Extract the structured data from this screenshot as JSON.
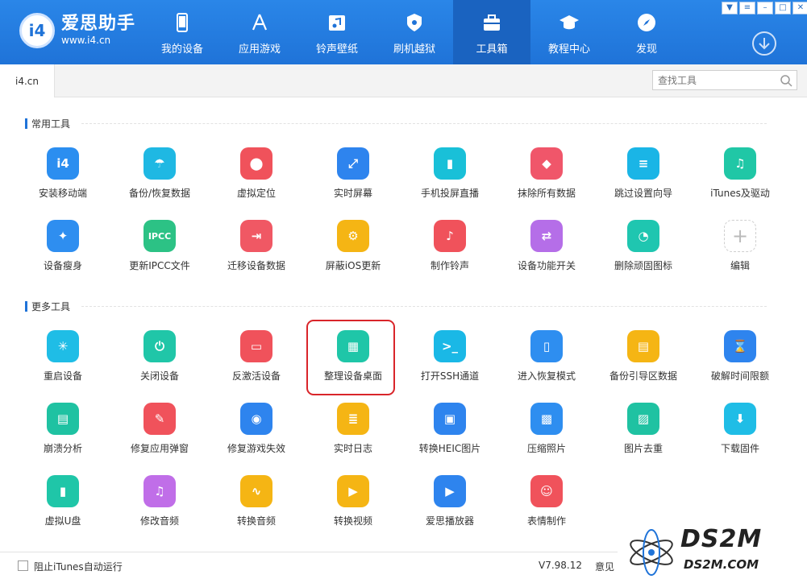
{
  "app": {
    "brand_name": "爱思助手",
    "brand_url": "www.i4.cn",
    "logo_text": "i4"
  },
  "window_buttons": [
    "shirt-icon",
    "menu-icon",
    "minimize-icon",
    "maximize-icon",
    "close-icon"
  ],
  "nav": [
    {
      "label": "我的设备",
      "icon": "phone-icon"
    },
    {
      "label": "应用游戏",
      "icon": "appstore-icon"
    },
    {
      "label": "铃声壁纸",
      "icon": "music-icon"
    },
    {
      "label": "刷机越狱",
      "icon": "flash-icon"
    },
    {
      "label": "工具箱",
      "icon": "toolbox-icon",
      "active": true
    },
    {
      "label": "教程中心",
      "icon": "graduation-icon"
    },
    {
      "label": "发现",
      "icon": "compass-icon"
    }
  ],
  "tabs": [
    {
      "label": "i4.cn"
    }
  ],
  "search": {
    "placeholder": "查找工具"
  },
  "sections": {
    "common": "常用工具",
    "more": "更多工具"
  },
  "common_tools": [
    {
      "label": "安装移动端",
      "color": "#2b8ef0",
      "glyph": "i4"
    },
    {
      "label": "备份/恢复数据",
      "color": "#1fb8e3",
      "glyph": "☂"
    },
    {
      "label": "虚拟定位",
      "color": "#f0525b",
      "glyph": "⬤"
    },
    {
      "label": "实时屏幕",
      "color": "#2e84ee",
      "glyph": "⤢"
    },
    {
      "label": "手机投屏直播",
      "color": "#19c0d8",
      "glyph": "▮"
    },
    {
      "label": "抹除所有数据",
      "color": "#f0566a",
      "glyph": "◆"
    },
    {
      "label": "跳过设置向导",
      "color": "#1ab5e6",
      "glyph": "≡"
    },
    {
      "label": "iTunes及驱动",
      "color": "#20c7a6",
      "glyph": "♫"
    },
    {
      "label": "设备瘦身",
      "color": "#2e8ef0",
      "glyph": "✦"
    },
    {
      "label": "更新IPCC文件",
      "color": "#2cc285",
      "glyph": "IPCC"
    },
    {
      "label": "迁移设备数据",
      "color": "#f05864",
      "glyph": "⇥"
    },
    {
      "label": "屏蔽iOS更新",
      "color": "#f5b514",
      "glyph": "⚙"
    },
    {
      "label": "制作铃声",
      "color": "#f0525b",
      "glyph": "♪"
    },
    {
      "label": "设备功能开关",
      "color": "#b56ee8",
      "glyph": "⇄"
    },
    {
      "label": "删除顽固图标",
      "color": "#1fc6b0",
      "glyph": "◔"
    },
    {
      "label": "编辑",
      "color": "#ffffff",
      "glyph": "+",
      "dashed": true
    }
  ],
  "more_tools": [
    {
      "label": "重启设备",
      "color": "#1fbde6",
      "glyph": "✳"
    },
    {
      "label": "关闭设备",
      "color": "#20c6a8",
      "glyph": "⏻"
    },
    {
      "label": "反激活设备",
      "color": "#f0525b",
      "glyph": "▭"
    },
    {
      "label": "整理设备桌面",
      "color": "#1fc6a8",
      "glyph": "▦"
    },
    {
      "label": "打开SSH通道",
      "color": "#1ab8e6",
      "glyph": ">_"
    },
    {
      "label": "进入恢复模式",
      "color": "#2e8ef0",
      "glyph": "▯"
    },
    {
      "label": "备份引导区数据",
      "color": "#f5b514",
      "glyph": "▤"
    },
    {
      "label": "破解时间限额",
      "color": "#2e84ee",
      "glyph": "⌛"
    },
    {
      "label": "崩溃分析",
      "color": "#1fc2a2",
      "glyph": "▤"
    },
    {
      "label": "修复应用弹窗",
      "color": "#f0525b",
      "glyph": "✎"
    },
    {
      "label": "修复游戏失效",
      "color": "#2e84ee",
      "glyph": "◉"
    },
    {
      "label": "实时日志",
      "color": "#f5b514",
      "glyph": "≣"
    },
    {
      "label": "转换HEIC图片",
      "color": "#2e84ee",
      "glyph": "▣"
    },
    {
      "label": "压缩照片",
      "color": "#2e8ef0",
      "glyph": "▩"
    },
    {
      "label": "图片去重",
      "color": "#1fc2a2",
      "glyph": "▨"
    },
    {
      "label": "下载固件",
      "color": "#1fbde6",
      "glyph": "⬇"
    },
    {
      "label": "虚拟U盘",
      "color": "#1fc6a8",
      "glyph": "▮"
    },
    {
      "label": "修改音频",
      "color": "#c06ee8",
      "glyph": "♫"
    },
    {
      "label": "转换音频",
      "color": "#f5b514",
      "glyph": "∿"
    },
    {
      "label": "转换视频",
      "color": "#f5b514",
      "glyph": "▶"
    },
    {
      "label": "爱思播放器",
      "color": "#2e84ee",
      "glyph": "▶"
    },
    {
      "label": "表情制作",
      "color": "#f0525b",
      "glyph": "☺"
    }
  ],
  "footer": {
    "checkbox_label": "阻止iTunes自动运行",
    "version": "V7.98.12",
    "feedback": "意见"
  },
  "watermark": {
    "line1": "DS2M",
    "line2": "DS2M.COM"
  }
}
